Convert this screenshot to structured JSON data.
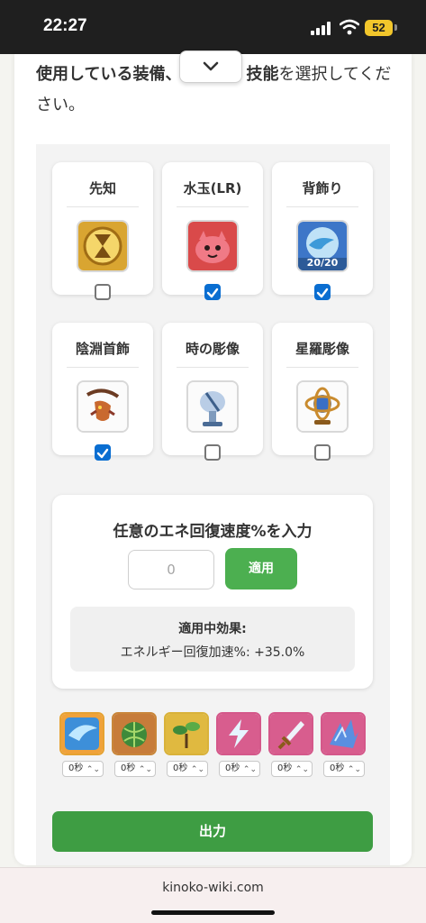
{
  "status_bar": {
    "time": "22:27",
    "battery": "52"
  },
  "instruction": {
    "part1": "使用している装備、",
    "part2": "能、技能",
    "part3": "を選択してください。"
  },
  "equipment": [
    {
      "name": "先知",
      "checked": false,
      "icon": "hourglass-icon",
      "color": "#d9a531"
    },
    {
      "name": "水玉(LR)",
      "checked": true,
      "icon": "red-slime-icon",
      "color": "#d94a4a"
    },
    {
      "name": "背飾り",
      "checked": true,
      "icon": "blue-wing-icon",
      "color": "#3d76c8",
      "badge": "20/20"
    },
    {
      "name": "陰淵首飾",
      "checked": true,
      "icon": "dragon-necklace-icon",
      "color": "#8b3a2a"
    },
    {
      "name": "時の彫像",
      "checked": false,
      "icon": "fountain-statue-icon",
      "color": "#6d8fb8"
    },
    {
      "name": "星羅彫像",
      "checked": false,
      "icon": "astrolabe-icon",
      "color": "#c98b2e"
    }
  ],
  "energy": {
    "title": "任意のエネ回復速度%を入力",
    "placeholder": "0",
    "apply_label": "適用",
    "effect_heading": "適用中効果:",
    "effect_value": "エネルギー回復加速%: +35.0%"
  },
  "skills": [
    {
      "icon": "wind-slash-icon",
      "value": "0秒"
    },
    {
      "icon": "melon-icon",
      "value": "0秒"
    },
    {
      "icon": "sprout-icon",
      "value": "0秒"
    },
    {
      "icon": "lightning-icon",
      "value": "0秒"
    },
    {
      "icon": "sword-icon",
      "value": "0秒"
    },
    {
      "icon": "ice-shard-icon",
      "value": "0秒"
    }
  ],
  "output_label": "出力",
  "url": "kinoko-wiki.com"
}
